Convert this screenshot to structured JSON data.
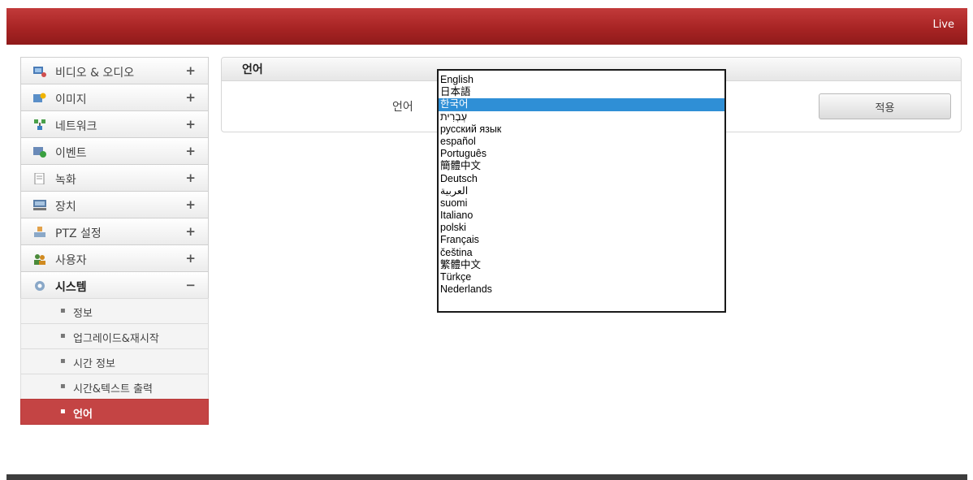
{
  "header": {
    "live_label": "Live"
  },
  "sidebar": {
    "items": [
      {
        "label": "비디오 & 오디오",
        "sign": "+",
        "icon": "video-audio-icon"
      },
      {
        "label": "이미지",
        "sign": "+",
        "icon": "image-icon"
      },
      {
        "label": "네트워크",
        "sign": "+",
        "icon": "network-icon"
      },
      {
        "label": "이벤트",
        "sign": "+",
        "icon": "event-icon"
      },
      {
        "label": "녹화",
        "sign": "+",
        "icon": "record-icon"
      },
      {
        "label": "장치",
        "sign": "+",
        "icon": "device-icon"
      },
      {
        "label": "PTZ 설정",
        "sign": "+",
        "icon": "ptz-icon"
      },
      {
        "label": "사용자",
        "sign": "+",
        "icon": "user-icon"
      },
      {
        "label": "시스템",
        "sign": "−",
        "icon": "system-icon"
      }
    ],
    "sub_items": [
      {
        "label": "정보"
      },
      {
        "label": "업그레이드&재시작"
      },
      {
        "label": "시간 정보"
      },
      {
        "label": "시간&텍스트 출력"
      },
      {
        "label": "언어",
        "active": true
      }
    ],
    "bullet": "▪"
  },
  "panel": {
    "title": "언어",
    "language_label": "언어",
    "apply_label": "적용"
  },
  "language_dropdown": {
    "selected": "한국어",
    "options": [
      "English",
      "日本語",
      "한국어",
      "עְבְרִית",
      "русский язык",
      "español",
      "Português",
      "簡體中文",
      "Deutsch",
      "العربية",
      "suomi",
      "Italiano",
      "polski",
      "Français",
      "čeština",
      "繁體中文",
      "Türkçe",
      "Nederlands"
    ]
  },
  "colors": {
    "topbar": "#a82424",
    "active_sub_item": "#c44444",
    "dropdown_highlight": "#2f8fd6"
  }
}
